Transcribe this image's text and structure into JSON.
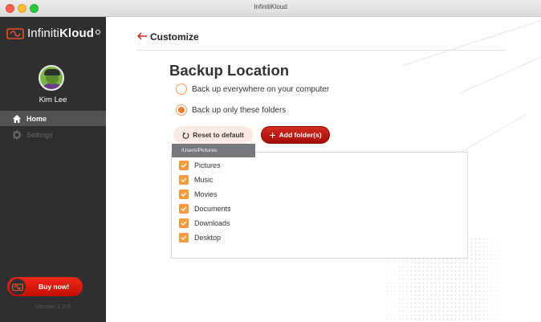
{
  "window": {
    "title": "InfinitiKloud"
  },
  "sidebar": {
    "logo_text_light": "Infiniti",
    "logo_text_bold": "Kloud",
    "username": "Kim Lee",
    "nav": [
      {
        "label": "Home",
        "icon": "home-icon",
        "active": true
      },
      {
        "label": "Settings",
        "icon": "gear-icon",
        "active": false
      }
    ],
    "buy_label": "Buy now!",
    "version": "Version 2.0.0"
  },
  "header": {
    "title": "Customize"
  },
  "backup": {
    "title": "Backup Location",
    "options": [
      {
        "label": "Back up everywhere on your computer",
        "selected": false
      },
      {
        "label": "Back up only these folders",
        "selected": true
      }
    ],
    "reset_label": "Reset to default",
    "add_label": "Add folder(s)",
    "tooltip": "/Users/Pictures",
    "folders": [
      {
        "label": "Pictures",
        "checked": true
      },
      {
        "label": "Music",
        "checked": true
      },
      {
        "label": "Movies",
        "checked": true
      },
      {
        "label": "Documents",
        "checked": true
      },
      {
        "label": "Downloads",
        "checked": true
      },
      {
        "label": "Desktop",
        "checked": true
      }
    ]
  },
  "colors": {
    "accent": "#f07d2c",
    "brand_red": "#c11005",
    "sidebar_bg": "#2f2f31"
  }
}
